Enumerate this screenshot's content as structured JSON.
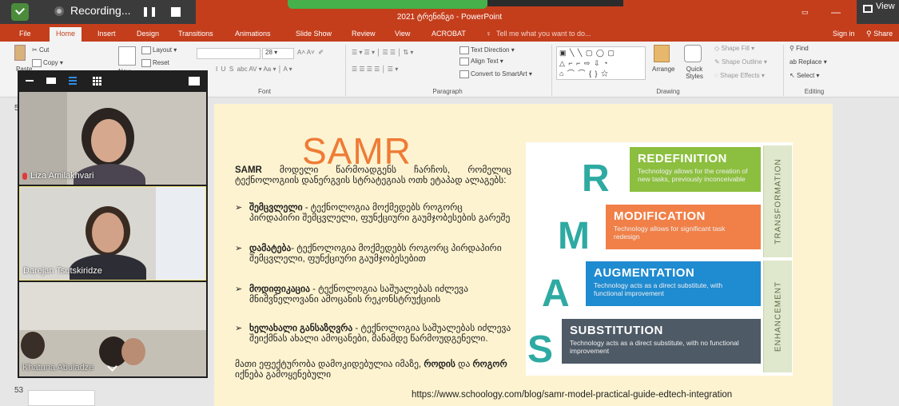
{
  "recording": {
    "label": "Recording..."
  },
  "window": {
    "title": "2021 ტრენინგი - PowerPoint"
  },
  "titlebar_right": {
    "view": "View",
    "signin": "Sign in",
    "share": "Share"
  },
  "tabs": [
    "File",
    "Home",
    "Insert",
    "Design",
    "Transitions",
    "Animations",
    "Slide Show",
    "Review",
    "View",
    "ACROBAT"
  ],
  "tell_me": "Tell me what you want to do...",
  "ribbon": {
    "clipboard": {
      "cut": "Cut",
      "copy": "Copy",
      "paste": "Paste"
    },
    "slides": {
      "layout": "Layout",
      "reset": "Reset",
      "new": "New"
    },
    "font": {
      "size": "28",
      "group": "Font"
    },
    "paragraph": {
      "text_direction": "Text Direction",
      "align_text": "Align Text",
      "convert": "Convert to SmartArt",
      "group": "Paragraph"
    },
    "drawing": {
      "arrange": "Arrange",
      "quick_styles": "Quick Styles",
      "shape_fill": "Shape Fill",
      "shape_outline": "Shape Outline",
      "shape_effects": "Shape Effects",
      "group": "Drawing"
    },
    "editing": {
      "find": "Find",
      "replace": "Replace",
      "select": "Select",
      "group": "Editing"
    }
  },
  "thumbnails": {
    "n52": "52",
    "n53": "53"
  },
  "participants": [
    {
      "name": "Liza Amilakhvari"
    },
    {
      "name": "Darejan Tsutskiridze"
    },
    {
      "name": "Khatuna Abuladze"
    }
  ],
  "slide": {
    "title": "SAMR",
    "intro_bold": "SAMR",
    "intro_rest": " მოდელი წარმოადგენს ჩარჩოს, რომელიც ტექნოლოგიის დანერგვის სტრატეგიას ოთხ ეტაპად ალაგებს:",
    "bullets": [
      {
        "bold": "შემცვლელი",
        "rest": " - ტექნოლოგია მოქმედებს როგორც პირდაპირი შემცვლელი, ფუნქციური გაუმჯობესების გარეშე"
      },
      {
        "bold": "დამატება",
        "rest": "- ტექნოლოგია მოქმედებს როგორც პირდაპირი შემცვლელი, ფუნქციური გაუმჯობესებით"
      },
      {
        "bold": "მოდიფიკაცია",
        "rest": " - ტექნოლოგია საშუალებას იძლევა მნიშვნელოვანი ამოცანის რეკონსტრუქციის"
      },
      {
        "bold": "ხელახალი განსაზღვრა",
        "rest": " - ტექნოლოგია საშუალებას იძლევა შეიქმნას ახალი ამოცანები, მანამდე წარმოუდგენელი."
      }
    ],
    "closing_a": "მათი ეფექტურობა დამოკიდებულია იმაზე, ",
    "closing_b": "როდის",
    "closing_c": " და ",
    "closing_d": "როგორ",
    "closing_e": " იქნება გამოყენებული",
    "url": "https://www.schoology.com/blog/samr-model-practical-guide-edtech-integration",
    "levels": [
      {
        "letter": "R",
        "title": "REDEFINITION",
        "desc": "Technology allows for the creation of new tasks, previously inconceivable",
        "color": "#8cbf3f"
      },
      {
        "letter": "M",
        "title": "MODIFICATION",
        "desc": "Technology allows for significant task redesign",
        "color": "#f08048"
      },
      {
        "letter": "A",
        "title": "AUGMENTATION",
        "desc": "Technology acts as a direct substitute, with functional improvement",
        "color": "#1f8bd0"
      },
      {
        "letter": "S",
        "title": "SUBSTITUTION",
        "desc": "Technology acts as a direct substitute, with no functional improvement",
        "color": "#4e5a66"
      }
    ],
    "side_labels": {
      "top": "TRANSFORMATION",
      "bottom": "ENHANCEMENT"
    }
  }
}
